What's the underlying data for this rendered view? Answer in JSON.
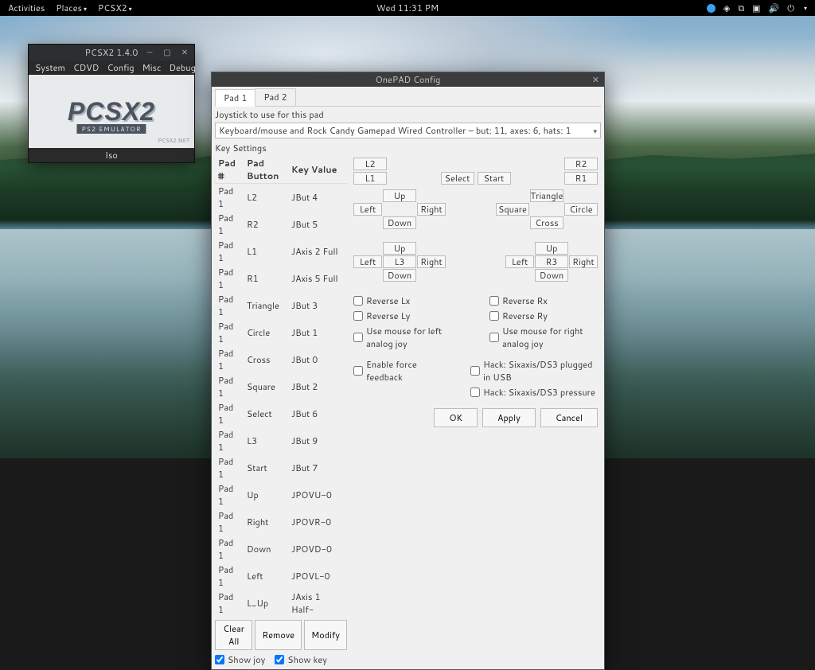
{
  "topbar": {
    "activities": "Activities",
    "places": "Places",
    "app": "PCSX2",
    "clock": "Wed 11:31 PM"
  },
  "pcsx2": {
    "title": "PCSX2 1.4.0",
    "menu": [
      "System",
      "CDVD",
      "Config",
      "Misc",
      "Debug"
    ],
    "logo": "PCSX2",
    "sub": "PS2 EMULATOR",
    "net": "PCSX2.NET",
    "status": "Iso"
  },
  "onepad": {
    "title": "OnePAD Config",
    "tabs": [
      "Pad 1",
      "Pad 2"
    ],
    "joy_label": "Joystick to use for this pad",
    "joy_value": "Keyboard/mouse and Rock Candy Gamepad Wired Controller – but: 11, axes: 6, hats: 1",
    "key_label": "Key Settings",
    "headers": [
      "Pad #",
      "Pad Button",
      "Key Value"
    ],
    "rows": [
      [
        "Pad 1",
        "L2",
        "JBut 4"
      ],
      [
        "Pad 1",
        "R2",
        "JBut 5"
      ],
      [
        "Pad 1",
        "L1",
        "JAxis 2 Full"
      ],
      [
        "Pad 1",
        "R1",
        "JAxis 5 Full"
      ],
      [
        "Pad 1",
        "Triangle",
        "JBut 3"
      ],
      [
        "Pad 1",
        "Circle",
        "JBut 1"
      ],
      [
        "Pad 1",
        "Cross",
        "JBut 0"
      ],
      [
        "Pad 1",
        "Square",
        "JBut 2"
      ],
      [
        "Pad 1",
        "Select",
        "JBut 6"
      ],
      [
        "Pad 1",
        "L3",
        "JBut 9"
      ],
      [
        "Pad 1",
        "Start",
        "JBut 7"
      ],
      [
        "Pad 1",
        "Up",
        "JPOVU-0"
      ],
      [
        "Pad 1",
        "Right",
        "JPOVR-0"
      ],
      [
        "Pad 1",
        "Down",
        "JPOVD-0"
      ],
      [
        "Pad 1",
        "Left",
        "JPOVL-0"
      ],
      [
        "Pad 1",
        "L_Up",
        "JAxis 1 Half-"
      ]
    ],
    "clear_all": "Clear All",
    "remove": "Remove",
    "modify": "Modify",
    "show_joy": "Show joy",
    "show_key": "Show key",
    "btns": {
      "L2": "L2",
      "L1": "L1",
      "R2": "R2",
      "R1": "R1",
      "Select": "Select",
      "Start": "Start",
      "Up": "Up",
      "Down": "Down",
      "Left": "Left",
      "Right": "Right",
      "Triangle": "Triangle",
      "Circle": "Circle",
      "Cross": "Cross",
      "Square": "Square",
      "L3": "L3",
      "R3": "R3"
    },
    "checks": {
      "reverse_lx": "Reverse Lx",
      "reverse_ly": "Reverse Ly",
      "mouse_left": "Use mouse for left analog joy",
      "reverse_rx": "Reverse Rx",
      "reverse_ry": "Reverse Ry",
      "mouse_right": "Use mouse for right analog joy",
      "force_fb": "Enable force feedback",
      "hack_usb": "Hack: Sixaxis/DS3 plugged in USB",
      "hack_pres": "Hack: Sixaxis/DS3 pressure"
    },
    "ok": "OK",
    "apply": "Apply",
    "cancel": "Cancel"
  }
}
